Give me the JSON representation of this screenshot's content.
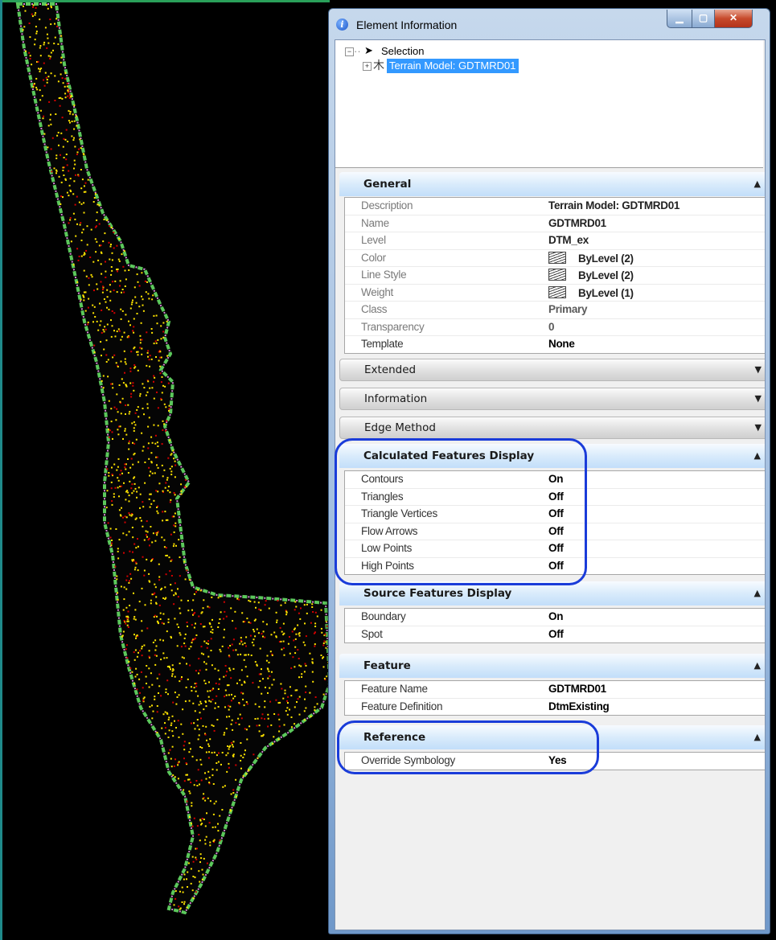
{
  "window": {
    "title": "Element Information",
    "icon": "info-icon"
  },
  "tree": {
    "root_label": "Selection",
    "child_label": "Terrain Model: GDTMRD01",
    "root_expander": "−",
    "child_expander": "+"
  },
  "icons": {
    "collapse": "▲",
    "expand": "▼",
    "root": "cursor-arrow-icon",
    "child": "terrain-model-icon"
  },
  "colors": {
    "highlight": "#1a3cd9",
    "selection": "#3399ff",
    "boundary": "#5cc85c",
    "point_yellow": "#ffe400",
    "point_red": "#d40000"
  },
  "sections": {
    "general": {
      "title": "General",
      "rows": [
        {
          "label": "Description",
          "value": "Terrain Model: GDTMRD01"
        },
        {
          "label": "Name",
          "value": "GDTMRD01"
        },
        {
          "label": "Level",
          "value": "DTM_ex"
        },
        {
          "label": "Color",
          "value": "ByLevel (2)"
        },
        {
          "label": "Line Style",
          "value": "ByLevel (2)"
        },
        {
          "label": "Weight",
          "value": "ByLevel (1)"
        },
        {
          "label": "Class",
          "value": "Primary"
        },
        {
          "label": "Transparency",
          "value": "0"
        },
        {
          "label": "Template",
          "value": "None"
        }
      ]
    },
    "extended": {
      "title": "Extended"
    },
    "information": {
      "title": "Information"
    },
    "edge_method": {
      "title": "Edge Method"
    },
    "calculated": {
      "title": "Calculated Features Display",
      "rows": [
        {
          "label": "Contours",
          "value": "On"
        },
        {
          "label": "Triangles",
          "value": "Off"
        },
        {
          "label": "Triangle Vertices",
          "value": "Off"
        },
        {
          "label": "Flow Arrows",
          "value": "Off"
        },
        {
          "label": "Low Points",
          "value": "Off"
        },
        {
          "label": "High Points",
          "value": "Off"
        }
      ]
    },
    "source": {
      "title": "Source Features Display",
      "rows": [
        {
          "label": "Boundary",
          "value": "On"
        },
        {
          "label": "Spot",
          "value": "Off"
        }
      ]
    },
    "feature": {
      "title": "Feature",
      "rows": [
        {
          "label": "Feature Name",
          "value": "GDTMRD01"
        },
        {
          "label": "Feature Definition",
          "value": "DtmExisting"
        }
      ]
    },
    "reference": {
      "title": "Reference",
      "rows": [
        {
          "label": "Override Symbology",
          "value": "Yes"
        }
      ]
    }
  }
}
